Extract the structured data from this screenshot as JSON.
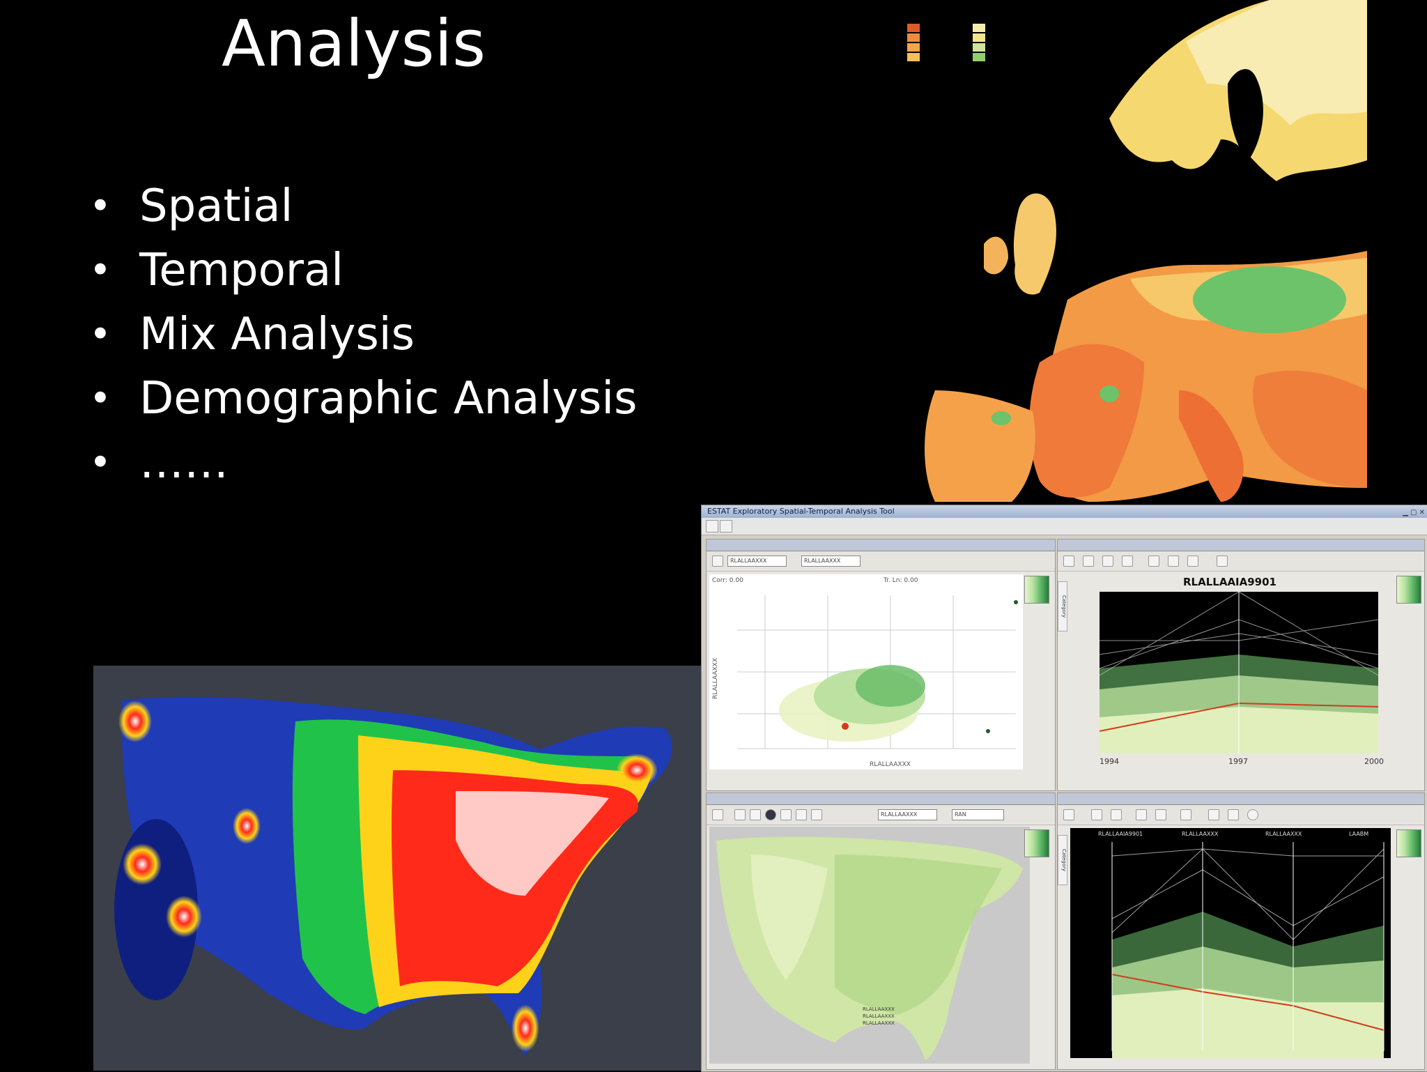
{
  "slide": {
    "title": "Analysis",
    "bullets": [
      "Spatial",
      "Temporal",
      "Mix Analysis",
      "Demographic Analysis",
      "……"
    ],
    "bullet_glyph": "•"
  },
  "colors": {
    "background": "#000000",
    "heat_low": "#1a2fa8",
    "heat_mid": "#22c44a",
    "heat_high": "#ff2a1a",
    "europe_warm": "#f07a3a",
    "europe_green": "#6cc36a"
  },
  "estat": {
    "window_title": "ESTAT Exploratory Spatial-Temporal Analysis Tool",
    "scatter": {
      "x_combo": "RLALLAAXXX",
      "y_combo": "RLALLAAXXX",
      "x_axis_label": "RLALLAAXXX",
      "y_axis_label": "RLALLAAXXX",
      "header_left": "Corr: 0.00",
      "header_center": "Tr. Ln: 0.00"
    },
    "time_series": {
      "title": "RLALLAAIA9901",
      "years": [
        "1994",
        "1997",
        "2000"
      ]
    },
    "map_panel": {
      "combo1": "RLALLAAXXX",
      "combo2": "RAN",
      "legend_lines": [
        "RLALLAAXXX",
        "RLALLAAXXX",
        "RLALLAAXXX"
      ]
    },
    "pcp": {
      "axis_labels": [
        "RLALLAAIA9901",
        "RLALLAAXXX",
        "RLALLAAXXX",
        "LAABM"
      ]
    },
    "side_tab_label": "Category"
  }
}
